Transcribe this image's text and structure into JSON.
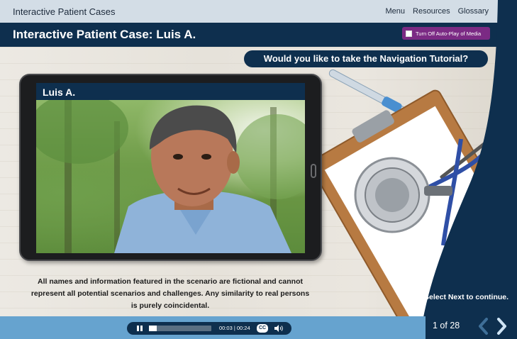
{
  "header": {
    "app_title": "Interactive Patient Cases",
    "nav": [
      "Menu",
      "Resources",
      "Glossary"
    ]
  },
  "title_bar": {
    "title": "Interactive Patient Case: Luis A.",
    "autoplay_label": "Turn Off Auto-Play of Media"
  },
  "tutorial_prompt": "Would you like to take the Navigation Tutorial?",
  "tablet": {
    "patient_name": "Luis A."
  },
  "disclaimer": "All names and information featured in the scenario are fictional and cannot represent all potential scenarios and challenges. Any similarity to real persons is purely coincidental.",
  "footer": {
    "instruction": "Select Next to continue.",
    "page_indicator": "1 of 28"
  },
  "media_player": {
    "time": "00:03 | 00:24",
    "cc_label": "CC",
    "progress": 0.125
  },
  "colors": {
    "navy": "#0e2f4e",
    "accent_blue": "#66a3cf",
    "autoplay_purple": "#7b2a84"
  }
}
